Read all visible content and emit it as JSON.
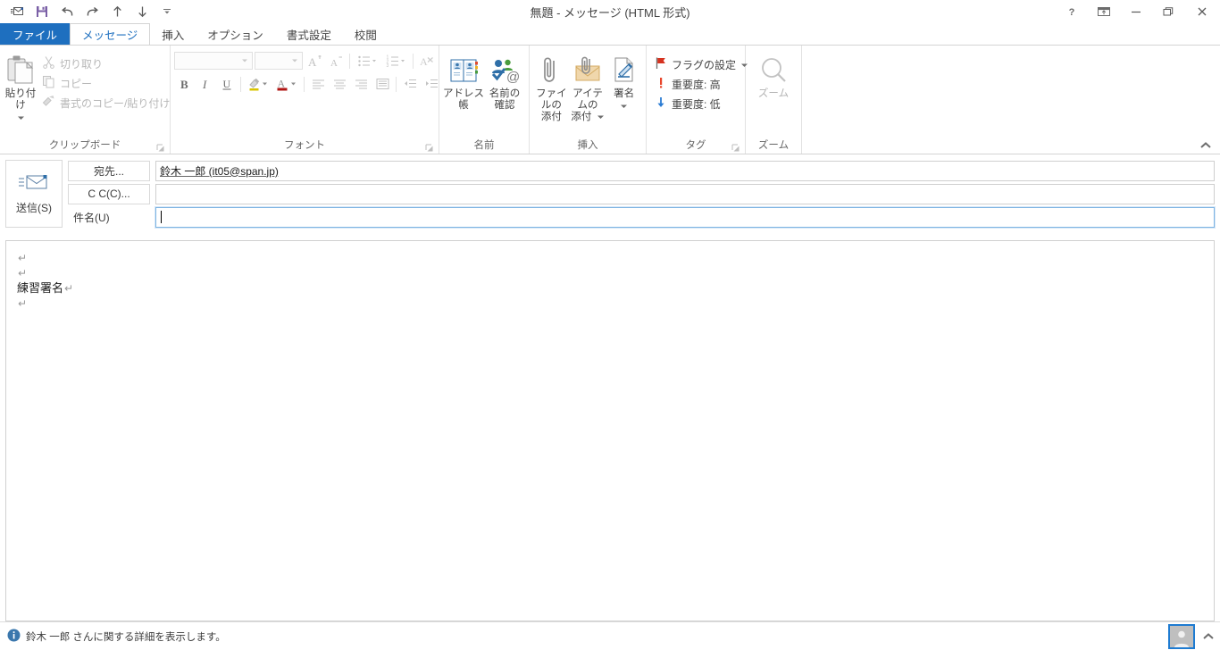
{
  "window": {
    "title": "無題 - メッセージ (HTML 形式)",
    "controls": {
      "help": "?",
      "ribbon_display": "リボンの表示オプション",
      "minimize": "最小化",
      "restore": "元のサイズに戻す",
      "close": "閉じる"
    }
  },
  "quick_access": {
    "items": [
      {
        "name": "send-receive-icon",
        "tooltip": "送受信"
      },
      {
        "name": "save-icon",
        "tooltip": "上書き保存"
      },
      {
        "name": "undo-icon",
        "tooltip": "元に戻す"
      },
      {
        "name": "redo-icon",
        "tooltip": "やり直し"
      },
      {
        "name": "previous-item-icon",
        "tooltip": "前のアイテム"
      },
      {
        "name": "next-item-icon",
        "tooltip": "次のアイテム"
      },
      {
        "name": "customize-qat-icon",
        "tooltip": "クイック アクセス ツール バーのユーザー設定"
      }
    ]
  },
  "tabs": [
    {
      "label": "ファイル",
      "type": "file"
    },
    {
      "label": "メッセージ",
      "type": "active"
    },
    {
      "label": "挿入",
      "type": "normal"
    },
    {
      "label": "オプション",
      "type": "normal"
    },
    {
      "label": "書式設定",
      "type": "normal"
    },
    {
      "label": "校閲",
      "type": "normal"
    }
  ],
  "ribbon": {
    "collapse_tooltip": "リボンを折りたたむ",
    "groups": {
      "clipboard": {
        "title": "クリップボード",
        "paste": "貼り付け",
        "cut": "切り取り",
        "copy": "コピー",
        "format_painter": "書式のコピー/貼り付け"
      },
      "font": {
        "title": "フォント",
        "font_name_value": "",
        "font_size_value": "",
        "buttons": [
          "フォント サイズの拡大",
          "フォント サイズの縮小",
          "箇条書き",
          "段落番号",
          "書式のクリア",
          "太字",
          "斜体",
          "下線",
          "蛍光ペンの色",
          "フォントの色",
          "左揃え",
          "中央揃え",
          "右揃え",
          "両端揃え",
          "インデントを減らす",
          "インデントを増やす"
        ]
      },
      "names": {
        "title": "名前",
        "address_book": "アドレス帳",
        "check_names_line1": "名前の",
        "check_names_line2": "確認"
      },
      "include": {
        "title": "挿入",
        "attach_file_line1": "ファイルの",
        "attach_file_line2": "添付",
        "attach_item_line1": "アイテムの",
        "attach_item_line2": "添付",
        "signature": "署名"
      },
      "tags": {
        "title": "タグ",
        "follow_up": "フラグの設定",
        "high_importance": "重要度: 高",
        "low_importance": "重要度: 低"
      },
      "zoom": {
        "title": "ズーム",
        "zoom_button": "ズーム"
      }
    }
  },
  "compose": {
    "send_button": "送信(S)",
    "to_button": "宛先...",
    "cc_button": "C C(C)...",
    "subject_label": "件名(U)",
    "to_value": "鈴木 一郎 (it05@span.jp)",
    "cc_value": "",
    "subject_value": ""
  },
  "body": {
    "lines": [
      {
        "text": "",
        "mark": "↵"
      },
      {
        "text": "",
        "mark": "↵"
      },
      {
        "text": "練習署名",
        "mark": "↵"
      },
      {
        "text": "",
        "mark": "↵"
      }
    ]
  },
  "status": {
    "info_text": "鈴木 一郎 さんに関する詳細を表示します。",
    "avatar": "contact-photo",
    "expand": "people-pane-expand"
  },
  "colors": {
    "file_tab": "#1e6fbf",
    "active_tab_text": "#1e6fbf",
    "accent_blue": "#1e7bd1",
    "flag_red": "#d6321f",
    "importance_high": "#e8452a",
    "importance_low": "#2b7cd3",
    "attach_item_gold": "#e8c48a",
    "focus_border": "#7eb4e2"
  }
}
